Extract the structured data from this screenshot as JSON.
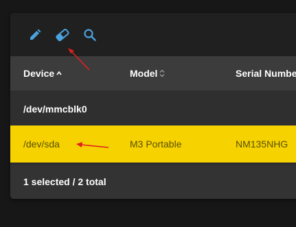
{
  "toolbar": {
    "icons": [
      "pencil-icon",
      "eraser-icon",
      "search-icon"
    ],
    "icon_color": "#4aa3df"
  },
  "table": {
    "columns": [
      {
        "label": "Device",
        "sort": "ascending"
      },
      {
        "label": "Model",
        "sort": "none"
      },
      {
        "label": "Serial Numbe",
        "sort": "none"
      }
    ],
    "rows": [
      {
        "device": "/dev/mmcblk0",
        "model": "",
        "serial": "",
        "selected": false
      },
      {
        "device": "/dev/sda",
        "model": "M3 Portable",
        "serial": "NM135NHG",
        "selected": true
      }
    ],
    "footer": "1 selected / 2 total"
  },
  "colors": {
    "selected_row": "#f6d200",
    "selected_text": "#5a5000",
    "annotation_arrow": "#e02020"
  }
}
